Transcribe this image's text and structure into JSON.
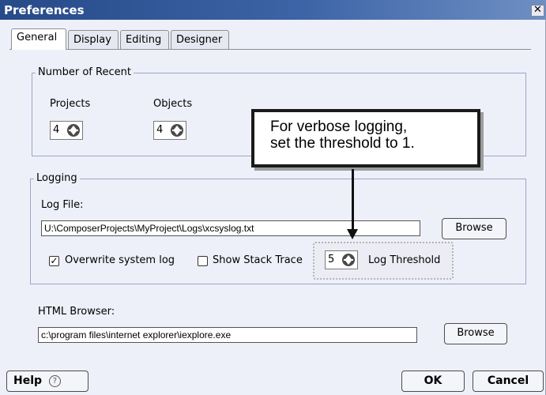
{
  "window": {
    "title": "Preferences",
    "close_glyph": "✕"
  },
  "tabs": [
    {
      "label": "General",
      "active": true
    },
    {
      "label": "Display",
      "active": false
    },
    {
      "label": "Editing",
      "active": false
    },
    {
      "label": "Designer",
      "active": false
    }
  ],
  "recent": {
    "legend": "Number of Recent",
    "projects_label": "Projects",
    "projects_value": "4",
    "objects_label": "Objects",
    "objects_value": "4"
  },
  "logging": {
    "legend": "Logging",
    "log_file_label": "Log File:",
    "log_file_value": "U:\\ComposerProjects\\MyProject\\Logs\\xcsyslog.txt",
    "browse_label": "Browse",
    "overwrite_label": "Overwrite system log",
    "overwrite_checked": true,
    "stack_trace_label": "Show Stack Trace",
    "stack_trace_checked": false,
    "threshold_value": "5",
    "threshold_label": "Log Threshold"
  },
  "html_browser": {
    "label": "HTML Browser:",
    "value": "c:\\program files\\internet explorer\\iexplore.exe",
    "browse_label": "Browse"
  },
  "callout": {
    "line1": "For verbose logging,",
    "line2": "set the threshold to 1."
  },
  "footer": {
    "help_label": "Help",
    "help_icon_glyph": "?",
    "ok_label": "OK",
    "cancel_label": "Cancel"
  },
  "colors": {
    "titlebar": "#3c64a6",
    "dialog_bg": "#eef0f9",
    "group_border": "#9fa4c8"
  }
}
